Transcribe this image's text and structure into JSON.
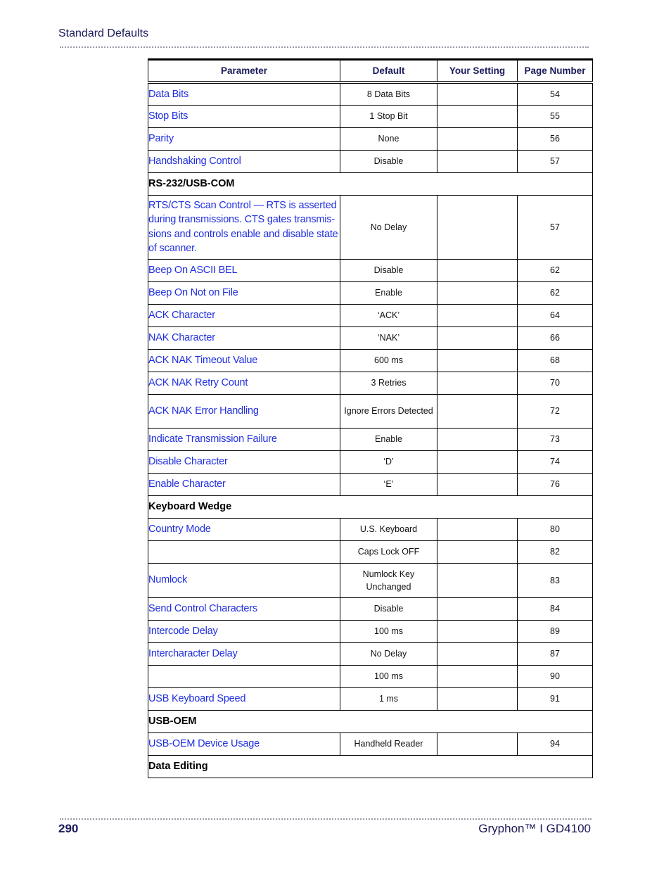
{
  "header": {
    "title": "Standard Defaults"
  },
  "table": {
    "columns": [
      "Parameter",
      "Default",
      "Your Setting",
      "Page Number"
    ],
    "rows": [
      {
        "type": "data",
        "parameter": "Data Bits",
        "default": "8 Data Bits",
        "setting": "",
        "page": "54"
      },
      {
        "type": "data",
        "parameter": "Stop Bits",
        "default": "1 Stop Bit",
        "setting": "",
        "page": "55"
      },
      {
        "type": "data",
        "parameter": "Parity",
        "default": "None",
        "setting": "",
        "page": "56"
      },
      {
        "type": "data",
        "parameter": "Handshaking Control",
        "default": "Disable",
        "setting": "",
        "page": "57"
      },
      {
        "type": "section",
        "label": "RS-232/USB-COM"
      },
      {
        "type": "data",
        "parameter": "RTS/CTS Scan Control — RTS is asserted during transmissions. CTS gates transmis-sions and controls enable and disable state of scanner.",
        "default": "No Delay",
        "setting": "",
        "page": "57"
      },
      {
        "type": "data",
        "parameter": "Beep On ASCII BEL",
        "default": "Disable",
        "setting": "",
        "page": "62"
      },
      {
        "type": "data",
        "parameter": "Beep On Not on File",
        "default": "Enable",
        "setting": "",
        "page": "62"
      },
      {
        "type": "data",
        "parameter": "ACK Character",
        "default": "‘ACK’",
        "setting": "",
        "page": "64"
      },
      {
        "type": "data",
        "parameter": "NAK Character",
        "default": "‘NAK’",
        "setting": "",
        "page": "66"
      },
      {
        "type": "data",
        "parameter": "ACK NAK Timeout Value",
        "default": "600 ms",
        "setting": "",
        "page": "68"
      },
      {
        "type": "data",
        "parameter": "ACK NAK Retry Count",
        "default": "3 Retries",
        "setting": "",
        "page": "70"
      },
      {
        "type": "data",
        "parameter": "ACK NAK Error Handling",
        "default": "Ignore Errors Detected",
        "setting": "",
        "page": "72"
      },
      {
        "type": "data",
        "parameter": "Indicate Transmission Failure",
        "default": "Enable",
        "setting": "",
        "page": "73"
      },
      {
        "type": "data",
        "parameter": "Disable Character",
        "default": "‘D’",
        "setting": "",
        "page": "74"
      },
      {
        "type": "data",
        "parameter": "Enable Character",
        "default": "‘E’",
        "setting": "",
        "page": "76"
      },
      {
        "type": "section",
        "label": "Keyboard Wedge"
      },
      {
        "type": "data",
        "parameter": "Country Mode",
        "default": "U.S. Keyboard",
        "setting": "",
        "page": "80"
      },
      {
        "type": "data",
        "parameter": "",
        "default": "Caps Lock OFF",
        "setting": "",
        "page": "82"
      },
      {
        "type": "data",
        "parameter": "Numlock",
        "default": "Numlock Key Unchanged",
        "setting": "",
        "page": "83"
      },
      {
        "type": "data",
        "parameter": "Send Control Characters",
        "default": "Disable",
        "setting": "",
        "page": "84"
      },
      {
        "type": "data",
        "parameter": "Intercode Delay",
        "default": "100 ms",
        "setting": "",
        "page": "89"
      },
      {
        "type": "data",
        "parameter": "Intercharacter Delay",
        "default": "No Delay",
        "setting": "",
        "page": "87"
      },
      {
        "type": "data",
        "parameter": "",
        "default": "100 ms",
        "setting": "",
        "page": "90"
      },
      {
        "type": "data",
        "parameter": "USB Keyboard Speed",
        "default": "1 ms",
        "setting": "",
        "page": "91"
      },
      {
        "type": "section",
        "label": "USB-OEM"
      },
      {
        "type": "data",
        "parameter": "USB-OEM Device Usage",
        "default": "Handheld Reader",
        "setting": "",
        "page": "94"
      },
      {
        "type": "section",
        "label": "Data Editing"
      }
    ]
  },
  "footer": {
    "page_number": "290",
    "product": "Gryphon™ I GD4100"
  },
  "colors": {
    "link": "#1f2ee0",
    "heading": "#1a1a5a"
  }
}
